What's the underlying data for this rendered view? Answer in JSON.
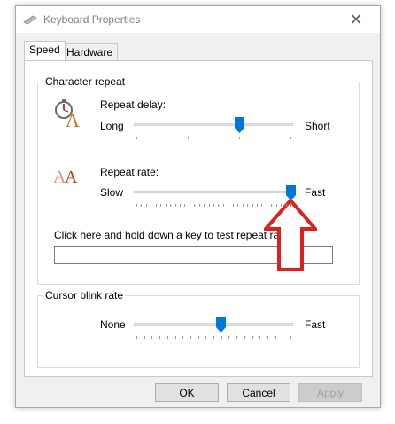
{
  "window": {
    "title": "Keyboard Properties",
    "close_glyph": "✕"
  },
  "tabs": [
    {
      "label": "Speed",
      "active": true
    },
    {
      "label": "Hardware",
      "active": false
    }
  ],
  "character_repeat": {
    "legend": "Character repeat",
    "repeat_delay": {
      "label": "Repeat delay:",
      "min_label": "Long",
      "max_label": "Short",
      "value_fraction": 0.67,
      "ticks": 4
    },
    "repeat_rate": {
      "label": "Repeat rate:",
      "min_label": "Slow",
      "max_label": "Fast",
      "value_fraction": 1.0,
      "ticks": 33
    },
    "test": {
      "label": "Click here and hold down a key to test repeat rate:",
      "value": ""
    }
  },
  "cursor_blink": {
    "legend": "Cursor blink rate",
    "min_label": "None",
    "max_label": "Fast",
    "value_fraction": 0.55,
    "ticks": 21
  },
  "buttons": {
    "ok": "OK",
    "cancel": "Cancel",
    "apply": "Apply"
  },
  "colors": {
    "thumb": "#0078d7",
    "annotation_arrow": "#e0201c",
    "dialog_bg": "#f0f0f0"
  },
  "icons": {
    "title": "keyboard-icon",
    "delay": "stopwatch-letter-icon",
    "rate": "double-letter-icon",
    "annotation": "up-arrow-annotation-icon"
  }
}
